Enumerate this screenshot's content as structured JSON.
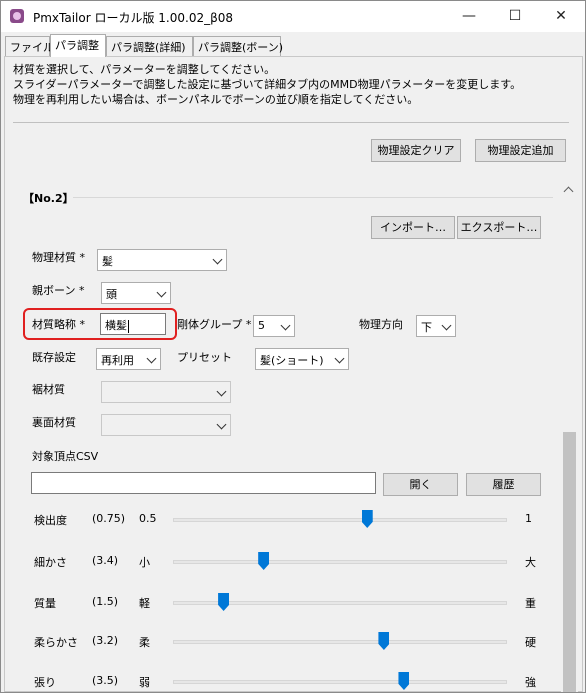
{
  "window": {
    "title": "PmxTailor ローカル版 1.00.02_β08",
    "min": "—",
    "max": "☐",
    "close": "✕"
  },
  "tabs": [
    {
      "label": "ファイル"
    },
    {
      "label": "パラ調整"
    },
    {
      "label": "パラ調整(詳細)"
    },
    {
      "label": "パラ調整(ボーン)"
    }
  ],
  "description": [
    "材質を選択して、パラメーターを調整してください。",
    "スライダーパラメーターで調整した設定に基づいて詳細タブ内のMMD物理パラメーターを変更します。",
    "物理を再利用したい場合は、ボーンパネルでボーンの並び順を指定してください。"
  ],
  "buttons": {
    "clear": "物理設定クリア",
    "add": "物理設定追加",
    "import": "インポート…",
    "export": "エクスポート…",
    "open": "開く",
    "history": "履歴"
  },
  "group": {
    "title": "【No.2】"
  },
  "form": {
    "physics_material_label": "物理材質 *",
    "physics_material_value": "髪",
    "parent_bone_label": "親ボーン *",
    "parent_bone_value": "頭",
    "abbrev_label": "材質略称 *",
    "abbrev_value": "横髪",
    "rigid_group_label": "剛体グループ *",
    "rigid_group_value": "5",
    "direction_label": "物理方向",
    "direction_value": "下",
    "existing_label": "既存設定",
    "existing_value": "再利用",
    "preset_label": "プリセット",
    "preset_value": "髪(ショート)",
    "hem_label": "裾材質",
    "back_label": "裏面材質",
    "csv_label": "対象頂点CSV",
    "csv_value": ""
  },
  "sliders": [
    {
      "label": "検出度",
      "value_text": "(0.75)",
      "min_label": "0.5",
      "max_label": "1",
      "fraction": 0.58
    },
    {
      "label": "細かさ",
      "value_text": "(3.4)",
      "min_label": "小",
      "max_label": "大",
      "fraction": 0.27
    },
    {
      "label": "質量",
      "value_text": "(1.5)",
      "min_label": "軽",
      "max_label": "重",
      "fraction": 0.15
    },
    {
      "label": "柔らかさ",
      "value_text": "(3.2)",
      "min_label": "柔",
      "max_label": "硬",
      "fraction": 0.63
    },
    {
      "label": "張り",
      "value_text": "(3.5)",
      "min_label": "弱",
      "max_label": "強",
      "fraction": 0.69
    }
  ],
  "colors": {
    "accent": "#0078d7",
    "highlight": "#e02020"
  }
}
